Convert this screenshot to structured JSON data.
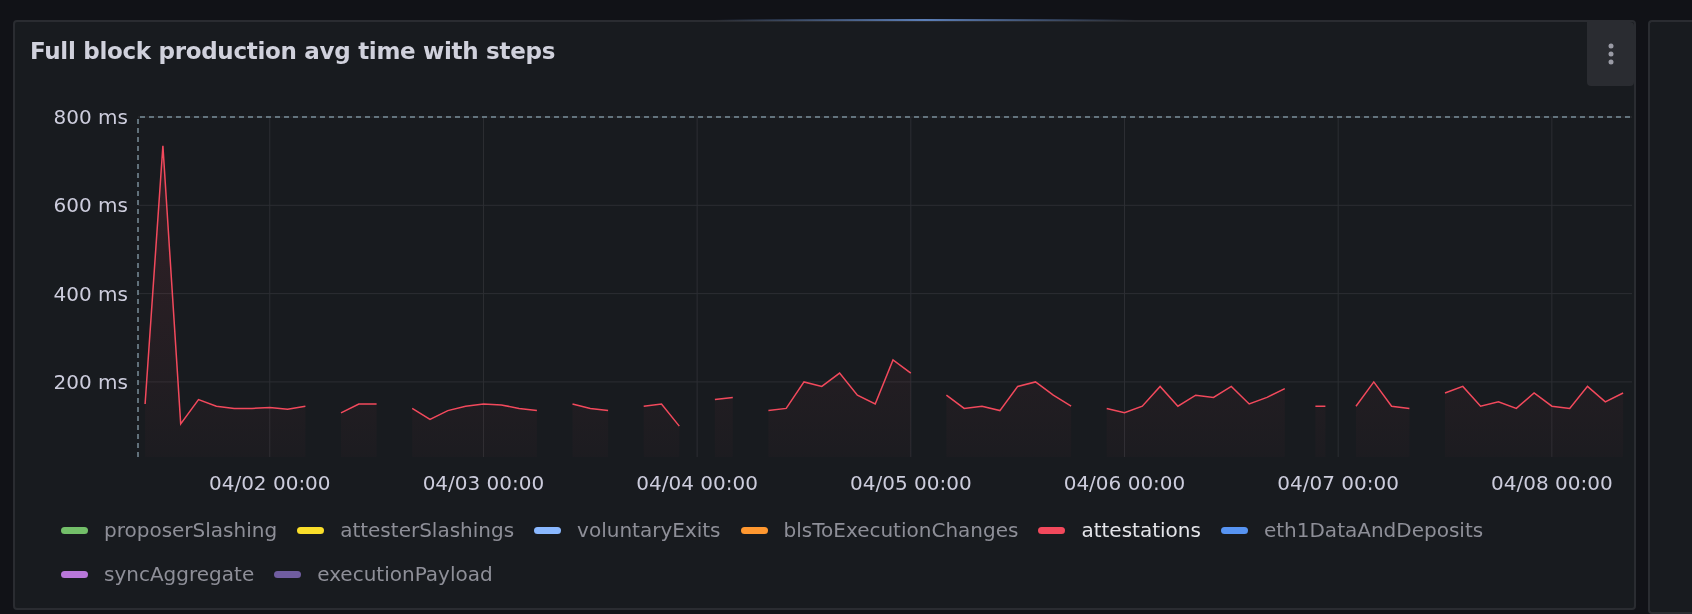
{
  "panel": {
    "title": "Full block production avg time with steps",
    "chart_data": {
      "type": "area",
      "grid": true,
      "ylim": [
        30,
        800
      ],
      "yticks": [
        {
          "value": 200,
          "label": "200 ms"
        },
        {
          "value": 400,
          "label": "400 ms"
        },
        {
          "value": 600,
          "label": "600 ms"
        },
        {
          "value": 800,
          "label": "800 ms"
        }
      ],
      "categories": [
        null,
        null,
        null,
        null,
        null,
        null,
        null,
        "04/02 00:00",
        null,
        null,
        null,
        null,
        null,
        null,
        null,
        null,
        null,
        null,
        null,
        "04/03 00:00",
        null,
        null,
        null,
        null,
        null,
        null,
        null,
        null,
        null,
        null,
        null,
        "04/04 00:00",
        null,
        null,
        null,
        null,
        null,
        null,
        null,
        null,
        null,
        null,
        null,
        "04/05 00:00",
        null,
        null,
        null,
        null,
        null,
        null,
        null,
        null,
        null,
        null,
        null,
        "04/06 00:00",
        null,
        null,
        null,
        null,
        null,
        null,
        null,
        null,
        null,
        null,
        null,
        "04/07 00:00",
        null,
        null,
        null,
        null,
        null,
        null,
        null,
        null,
        null,
        null,
        null,
        "04/08 00:00",
        null,
        null,
        null,
        null
      ],
      "series": [
        {
          "name": "proposerSlashing",
          "color": "#73bf69",
          "values": [
            null,
            null,
            null,
            null,
            null,
            null,
            null,
            null,
            null,
            null,
            null,
            null,
            null,
            null,
            null,
            null,
            null,
            null,
            null,
            null,
            null,
            null,
            null,
            null,
            null,
            null,
            null,
            null,
            null,
            null,
            null,
            null,
            null,
            null,
            null,
            null,
            null,
            null,
            null,
            null,
            null,
            null,
            null,
            null,
            null,
            null,
            null,
            null,
            null,
            null,
            null,
            null,
            null,
            null,
            null,
            null,
            null,
            null,
            null,
            null,
            null,
            null,
            null,
            null,
            null,
            null,
            null,
            null,
            null,
            null,
            null,
            null,
            null,
            null,
            null,
            null,
            null,
            null,
            null,
            null,
            null,
            null,
            null,
            null
          ]
        },
        {
          "name": "attesterSlashings",
          "color": "#fade2a",
          "values": [
            null,
            null,
            null,
            null,
            null,
            null,
            null,
            null,
            null,
            null,
            null,
            null,
            null,
            null,
            null,
            null,
            null,
            null,
            null,
            null,
            null,
            null,
            null,
            null,
            null,
            null,
            null,
            null,
            null,
            null,
            null,
            null,
            null,
            null,
            null,
            null,
            null,
            null,
            null,
            null,
            null,
            null,
            null,
            null,
            null,
            null,
            null,
            null,
            null,
            null,
            null,
            null,
            null,
            null,
            null,
            null,
            null,
            null,
            null,
            null,
            null,
            null,
            null,
            null,
            null,
            null,
            null,
            null,
            null,
            null,
            null,
            null,
            null,
            null,
            null,
            null,
            null,
            null,
            null,
            null,
            null,
            null,
            null,
            null
          ]
        },
        {
          "name": "voluntaryExits",
          "color": "#8ab8ff",
          "values": [
            null,
            null,
            null,
            null,
            null,
            null,
            null,
            null,
            null,
            null,
            null,
            null,
            null,
            null,
            null,
            null,
            null,
            null,
            null,
            null,
            null,
            null,
            null,
            null,
            null,
            null,
            null,
            null,
            null,
            null,
            null,
            null,
            null,
            null,
            null,
            null,
            null,
            null,
            null,
            null,
            null,
            null,
            null,
            null,
            null,
            null,
            null,
            null,
            null,
            null,
            null,
            null,
            null,
            null,
            null,
            null,
            null,
            null,
            null,
            null,
            null,
            null,
            null,
            null,
            null,
            null,
            null,
            null,
            null,
            null,
            null,
            null,
            null,
            null,
            null,
            null,
            null,
            null,
            null,
            null,
            null,
            null,
            null,
            null
          ]
        },
        {
          "name": "blsToExecutionChanges",
          "color": "#ff9830",
          "values": [
            null,
            null,
            null,
            null,
            null,
            null,
            null,
            null,
            null,
            null,
            null,
            null,
            null,
            null,
            null,
            null,
            null,
            null,
            null,
            null,
            null,
            null,
            null,
            null,
            null,
            null,
            null,
            null,
            null,
            null,
            null,
            null,
            null,
            null,
            null,
            null,
            null,
            null,
            null,
            null,
            null,
            null,
            null,
            null,
            null,
            null,
            null,
            null,
            null,
            null,
            null,
            null,
            null,
            null,
            null,
            null,
            null,
            null,
            null,
            null,
            null,
            null,
            null,
            null,
            null,
            null,
            null,
            null,
            null,
            null,
            null,
            null,
            null,
            null,
            null,
            null,
            null,
            null,
            null,
            null,
            null,
            null,
            null,
            null
          ]
        },
        {
          "name": "attestations",
          "color": "#f2495c",
          "values": [
            150,
            735,
            105,
            160,
            145,
            140,
            140,
            142,
            138,
            145,
            null,
            130,
            150,
            150,
            null,
            140,
            115,
            135,
            145,
            150,
            148,
            140,
            135,
            null,
            150,
            140,
            135,
            null,
            145,
            150,
            100,
            null,
            160,
            165,
            null,
            135,
            140,
            200,
            190,
            220,
            170,
            150,
            250,
            220,
            null,
            170,
            140,
            145,
            135,
            190,
            200,
            170,
            145,
            null,
            140,
            130,
            145,
            190,
            145,
            170,
            165,
            190,
            150,
            165,
            185,
            null,
            145,
            null,
            145,
            200,
            145,
            140,
            null,
            175,
            190,
            145,
            155,
            140,
            175,
            145,
            140,
            190,
            155,
            175
          ]
        },
        {
          "name": "eth1DataAndDeposits",
          "color": "#5794f2",
          "values": [
            null,
            null,
            null,
            null,
            null,
            null,
            null,
            null,
            null,
            null,
            null,
            null,
            null,
            null,
            null,
            null,
            null,
            null,
            null,
            null,
            null,
            null,
            null,
            null,
            null,
            null,
            null,
            null,
            null,
            null,
            null,
            null,
            null,
            null,
            null,
            null,
            null,
            null,
            null,
            null,
            null,
            null,
            null,
            null,
            null,
            null,
            null,
            null,
            null,
            null,
            null,
            null,
            null,
            null,
            null,
            null,
            null,
            null,
            null,
            null,
            null,
            null,
            null,
            null,
            null,
            null,
            null,
            null,
            null,
            null,
            null,
            null,
            null,
            null,
            null,
            null,
            null,
            null,
            null,
            null,
            null,
            null,
            null,
            null
          ]
        },
        {
          "name": "syncAggregate",
          "color": "#b877d9",
          "values": [
            null,
            null,
            null,
            null,
            null,
            null,
            null,
            null,
            null,
            null,
            null,
            null,
            null,
            null,
            null,
            null,
            null,
            null,
            null,
            null,
            null,
            null,
            null,
            null,
            null,
            null,
            null,
            null,
            null,
            null,
            null,
            null,
            null,
            null,
            null,
            null,
            null,
            null,
            null,
            null,
            null,
            null,
            null,
            null,
            null,
            null,
            null,
            null,
            null,
            null,
            null,
            null,
            null,
            null,
            null,
            null,
            null,
            null,
            null,
            null,
            null,
            null,
            null,
            null,
            null,
            null,
            null,
            null,
            null,
            null,
            null,
            null,
            null,
            null,
            null,
            null,
            null,
            null,
            null,
            null,
            null,
            null,
            null,
            null
          ]
        },
        {
          "name": "executionPayload",
          "color": "#705da0",
          "values": [
            null,
            null,
            null,
            null,
            null,
            null,
            null,
            null,
            null,
            null,
            null,
            null,
            null,
            null,
            null,
            null,
            null,
            null,
            null,
            null,
            null,
            null,
            null,
            null,
            null,
            null,
            null,
            null,
            null,
            null,
            null,
            null,
            null,
            null,
            null,
            null,
            null,
            null,
            null,
            null,
            null,
            null,
            null,
            null,
            null,
            null,
            null,
            null,
            null,
            null,
            null,
            null,
            null,
            null,
            null,
            null,
            null,
            null,
            null,
            null,
            null,
            null,
            null,
            null,
            null,
            null,
            null,
            null,
            null,
            null,
            null,
            null,
            null,
            null,
            null,
            null,
            null,
            null,
            null,
            null,
            null,
            null,
            null,
            null
          ]
        }
      ]
    },
    "legend": [
      {
        "selected": false
      },
      {
        "selected": false
      },
      {
        "selected": false
      },
      {
        "selected": false
      },
      {
        "selected": true
      },
      {
        "selected": false
      },
      {
        "selected": false
      },
      {
        "selected": false
      }
    ]
  }
}
